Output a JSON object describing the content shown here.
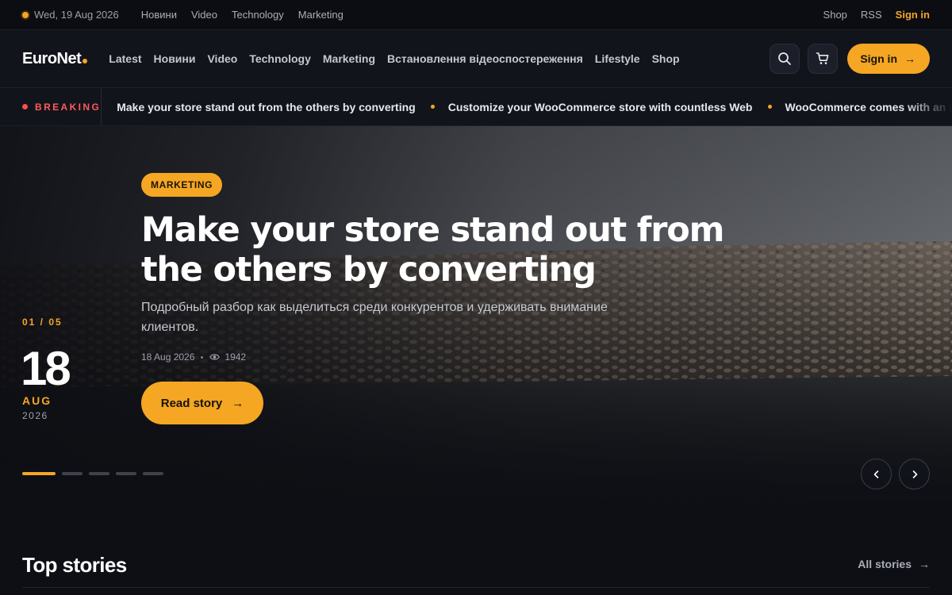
{
  "topbar": {
    "date": "Wed, 19 Aug 2026",
    "links": [
      "Новини",
      "Video",
      "Technology",
      "Marketing"
    ],
    "right_links": [
      "Shop",
      "RSS"
    ],
    "sign_in": "Sign in"
  },
  "header": {
    "logo": "EuroNet",
    "nav": [
      "Latest",
      "Новини",
      "Video",
      "Technology",
      "Marketing",
      "Встановлення відеоспостереження",
      "Lifestyle",
      "Shop"
    ],
    "search_icon": "search-icon",
    "cart_icon": "cart-icon",
    "sign_in_button": "Sign in"
  },
  "breaking": {
    "label": "BREAKING",
    "items": [
      "Make your store stand out from the others by converting",
      "Customize your WooCommerce store with countless Web",
      "WooCommerce comes with an intuitive"
    ]
  },
  "hero": {
    "tag": "MARKETING",
    "headline": "Make your store stand out from the others by converting",
    "subtitle": "Подробный разбор как выделиться среди конкурентов и удерживать внимание клиентов.",
    "date": "18 Aug 2026",
    "views": "1942",
    "read_button": "Read story",
    "counter": "01 / 05",
    "day": "18",
    "month": "AUG",
    "year": "2026",
    "slides_total": 5,
    "active_slide": 1
  },
  "top_stories": {
    "title": "Top stories",
    "all_link": "All stories"
  },
  "colors": {
    "accent": "#f5a623",
    "breaking": "#ff5a5a",
    "background": "#0d0f14"
  }
}
